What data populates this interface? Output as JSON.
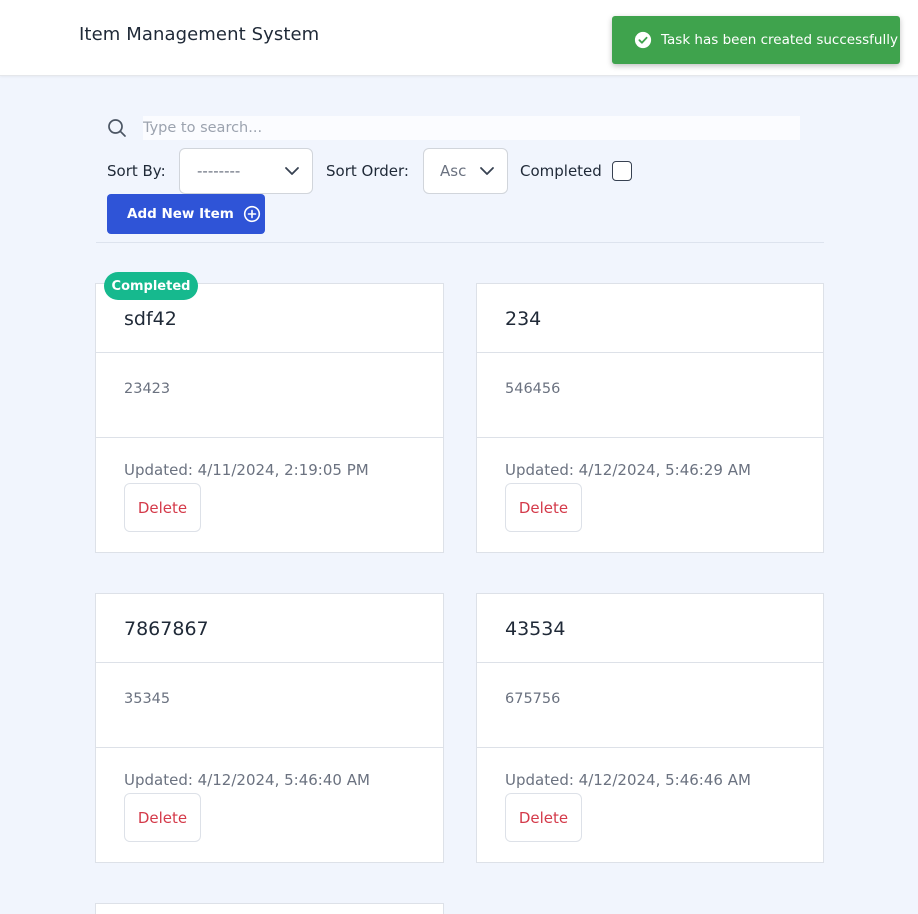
{
  "header": {
    "title": "Item Management System"
  },
  "toast": {
    "message": "Task has been created successfully"
  },
  "search": {
    "placeholder": "Type to search..."
  },
  "filters": {
    "sort_by_label": "Sort By:",
    "sort_by_value": "--------",
    "sort_order_label": "Sort Order:",
    "sort_order_value": "Asc",
    "completed_label": "Completed"
  },
  "add_button": {
    "label": "Add New Item"
  },
  "items": [
    {
      "title": "sdf42",
      "description": "23423",
      "updated": "Updated: 4/11/2024, 2:19:05 PM",
      "delete_label": "Delete",
      "badge": "Completed"
    },
    {
      "title": "234",
      "description": "546456",
      "updated": "Updated: 4/12/2024, 5:46:29 AM",
      "delete_label": "Delete"
    },
    {
      "title": "7867867",
      "description": "35345",
      "updated": "Updated: 4/12/2024, 5:46:40 AM",
      "delete_label": "Delete"
    },
    {
      "title": "43534",
      "description": "675756",
      "updated": "Updated: 4/12/2024, 5:46:46 AM",
      "delete_label": "Delete"
    }
  ],
  "colors": {
    "primary": "#2f54d7",
    "success": "#3fa34d",
    "completed_badge": "#16b98e",
    "danger": "#d43a4a",
    "background": "#f1f5fd"
  }
}
